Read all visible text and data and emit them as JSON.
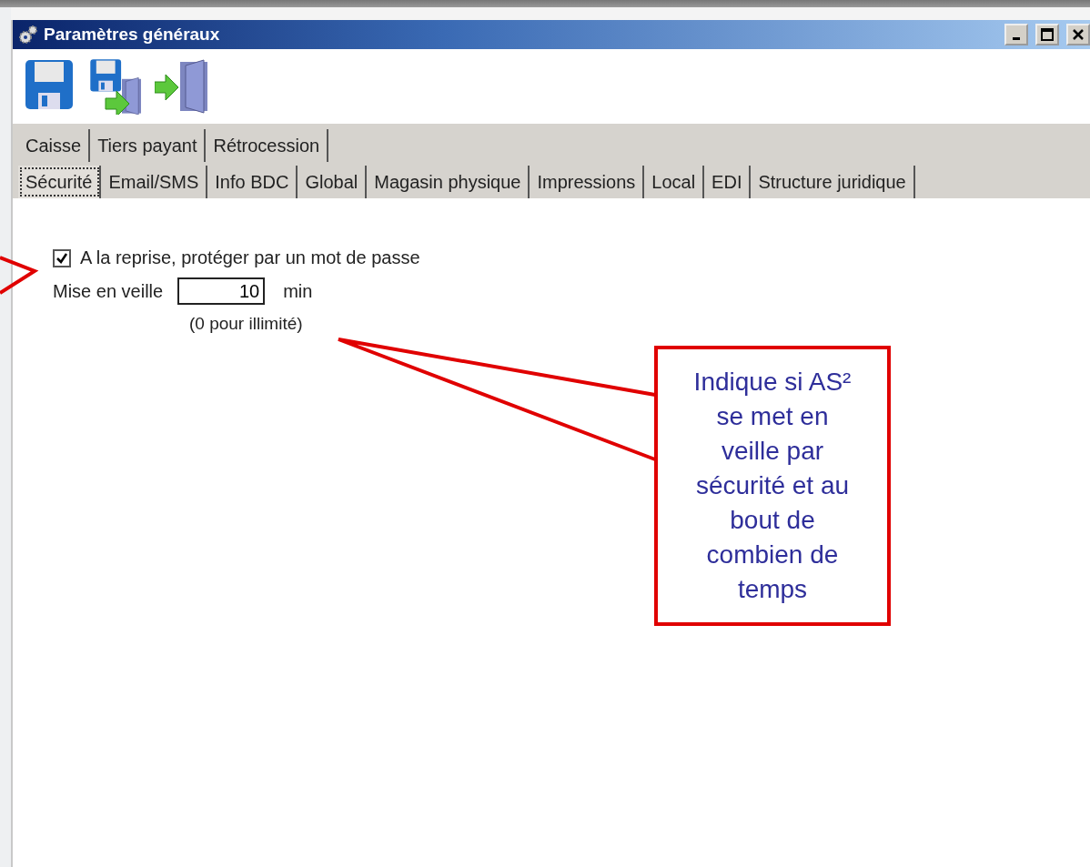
{
  "window": {
    "title": "Paramètres généraux",
    "controls": [
      {
        "kind": "minimize"
      },
      {
        "kind": "maximize"
      },
      {
        "kind": "close"
      }
    ]
  },
  "toolbar": [
    {
      "kind": "save"
    },
    {
      "kind": "save_exit"
    },
    {
      "kind": "exit"
    }
  ],
  "tab_rows": [
    [
      {
        "label": "Caisse",
        "selected": false
      },
      {
        "label": "Tiers payant",
        "selected": false
      },
      {
        "label": "Rétrocession",
        "selected": false
      }
    ],
    [
      {
        "label": "Sécurité",
        "selected": true
      },
      {
        "label": "Email/SMS",
        "selected": false
      },
      {
        "label": "Info BDC",
        "selected": false
      },
      {
        "label": "Global",
        "selected": false
      },
      {
        "label": "Magasin physique",
        "selected": false
      },
      {
        "label": "Impressions",
        "selected": false
      },
      {
        "label": "Local",
        "selected": false
      },
      {
        "label": "EDI",
        "selected": false
      },
      {
        "label": "Structure juridique",
        "selected": false
      }
    ]
  ],
  "security": {
    "password_on_resume": {
      "label": "A la reprise, protéger par un mot de passe",
      "checked": true
    },
    "sleep": {
      "label": "Mise en veille",
      "value": "10",
      "unit": "min",
      "hint": "(0 pour illimité)"
    }
  },
  "callout": {
    "text": "Indique si AS² se met en veille par sécurité et au bout de combien de temps"
  }
}
